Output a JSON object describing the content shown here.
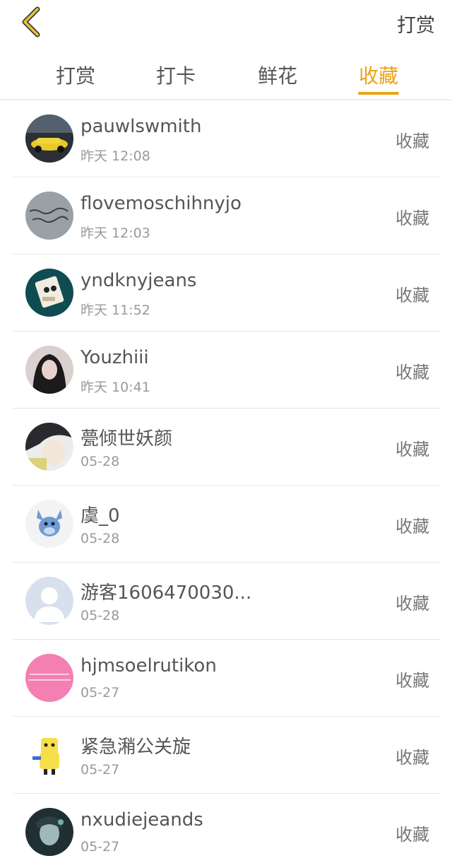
{
  "header": {
    "action_label": "打赏"
  },
  "tabs": [
    {
      "label": "打赏"
    },
    {
      "label": "打卡"
    },
    {
      "label": "鲜花"
    },
    {
      "label": "收藏"
    }
  ],
  "active_tab_index": 3,
  "accent_color": "#e8a317",
  "users": [
    {
      "name": "pauwlswmith",
      "time": "昨天 12:08",
      "action": "收藏"
    },
    {
      "name": "flovemoschihnyjo",
      "time": "昨天 12:03",
      "action": "收藏"
    },
    {
      "name": "yndknyjeans",
      "time": "昨天 11:52",
      "action": "收藏"
    },
    {
      "name": "Youzhiii",
      "time": "昨天 10:41",
      "action": "收藏"
    },
    {
      "name": "甍倾世妖颜",
      "time": "05-28",
      "action": "收藏"
    },
    {
      "name": "虞_0",
      "time": "05-28",
      "action": "收藏"
    },
    {
      "name": "游客1606470030...",
      "time": "05-28",
      "action": "收藏"
    },
    {
      "name": "hjmsoelrutikon",
      "time": "05-27",
      "action": "收藏"
    },
    {
      "name": "紧急潲公关旋",
      "time": "05-27",
      "action": "收藏"
    },
    {
      "name": "nxudiejeands",
      "time": "05-27",
      "action": "收藏"
    }
  ]
}
